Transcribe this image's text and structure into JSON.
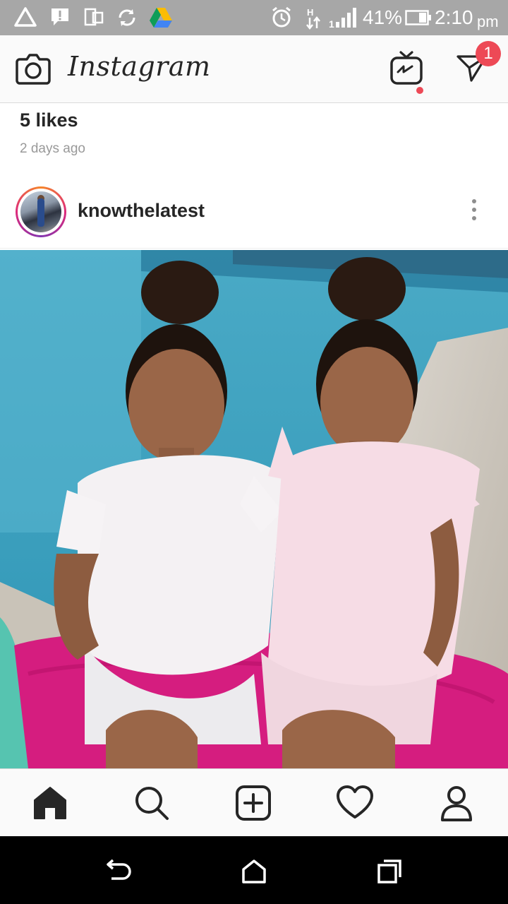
{
  "status_bar": {
    "battery_percent": "41%",
    "time": "2:10",
    "ampm": "pm",
    "icons": [
      "warning-triangle-icon",
      "alert-message-icon",
      "dual-screen-icon",
      "sync-icon",
      "drive-icon",
      "alarm-icon",
      "data-transfer-icon",
      "signal-icon",
      "battery-icon"
    ]
  },
  "header": {
    "app_name": "Instagram",
    "dm_badge_count": "1",
    "icons": [
      "camera-icon",
      "igtv-icon",
      "direct-message-icon"
    ]
  },
  "previous_post": {
    "likes": "5 likes",
    "time_ago": "2 days ago"
  },
  "post": {
    "username": "knowthelatest",
    "image_description_icon": "post-photo"
  },
  "bottom_nav": {
    "items": [
      {
        "name": "home",
        "icon": "home-icon",
        "active": true
      },
      {
        "name": "search",
        "icon": "search-icon",
        "active": false
      },
      {
        "name": "new-post",
        "icon": "add-post-icon",
        "active": false
      },
      {
        "name": "activity",
        "icon": "heart-icon",
        "active": false
      },
      {
        "name": "profile",
        "icon": "profile-icon",
        "active": false
      }
    ]
  },
  "system_nav": {
    "icons": [
      "back-icon",
      "home-button-icon",
      "recents-icon"
    ]
  },
  "colors": {
    "status_bar": "#a7a7a7",
    "header_bg": "#fafafa",
    "badge_red": "#ed4956",
    "text_primary": "#262626",
    "text_secondary": "#999999",
    "system_nav": "#000000"
  }
}
